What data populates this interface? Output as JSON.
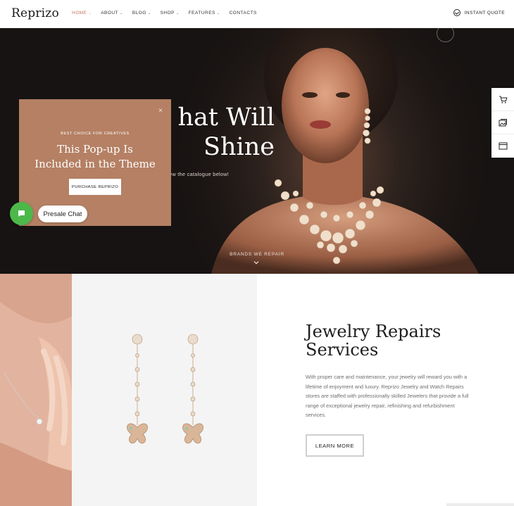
{
  "header": {
    "logo": "Reprizo",
    "nav": [
      {
        "label": "HOME",
        "caret": "⌄"
      },
      {
        "label": "ABOUT",
        "caret": "⌄"
      },
      {
        "label": "BLOG",
        "caret": "⌄"
      },
      {
        "label": "SHOP",
        "caret": "⌄"
      },
      {
        "label": "FEATURES",
        "caret": "⌄"
      },
      {
        "label": "CONTACTS",
        "caret": ""
      }
    ],
    "cta": "INSTANT QUOTE",
    "cta_icon": "check-circle-icon"
  },
  "hero": {
    "title_line1": "hat Will",
    "title_line2": "Shine",
    "subtitle": "ew the catalogue below!",
    "scroll_label": "BRANDS WE REPAIR",
    "scroll_icon": "chevron-down-icon"
  },
  "side_toolbar": {
    "icons": [
      "cart-icon",
      "gallery-icon",
      "window-icon"
    ]
  },
  "popup": {
    "eyebrow": "BEST CHOICE FOR CREATIVES",
    "title_line1": "This Pop-up Is",
    "title_line2": "Included in the Theme",
    "button": "PURCHASE REPRIZO",
    "close_icon": "×"
  },
  "chat": {
    "label": "Presale Chat",
    "icon": "chat-icon"
  },
  "repairs": {
    "title_line1": "Jewelry Repairs",
    "title_line2": "Services",
    "body": "With proper care and maintenance, your jewelry will reward you with a lifetime of enjoyment and luxury. Reprizo Jewelry and Watch Repairs stores are staffed with professionally skilled Jewelers that provide a full range of exceptional jewelry repair, refinishing and refurbishment services.",
    "button": "LEARN MORE"
  },
  "colors": {
    "accent": "#c4775a",
    "popup_bg": "#b58064",
    "chat_green": "#4cb84a",
    "hero_dark": "#1d1715"
  }
}
